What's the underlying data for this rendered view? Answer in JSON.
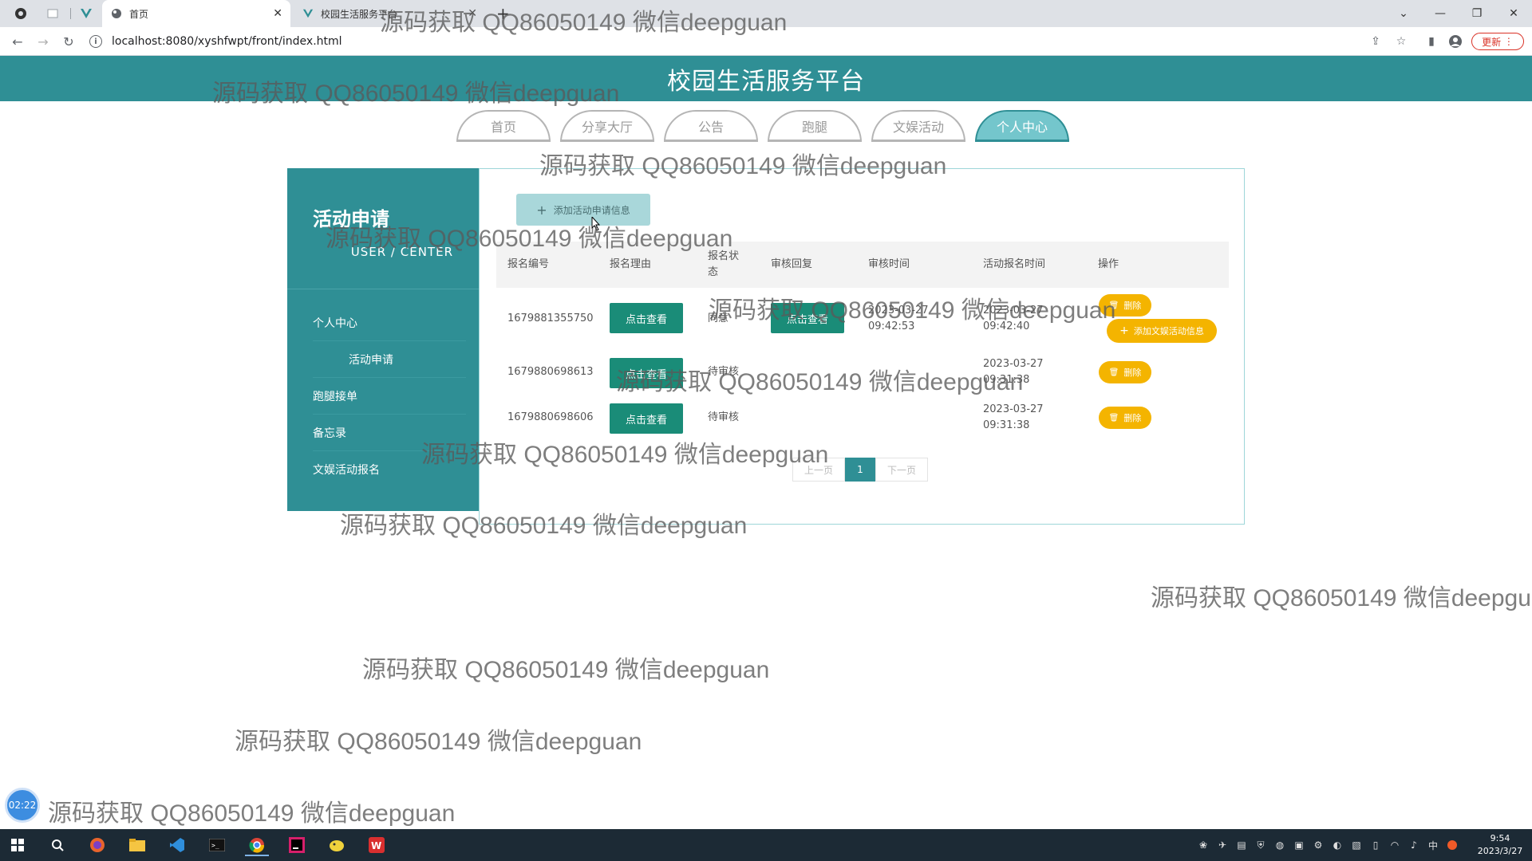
{
  "browser": {
    "tabs": [
      {
        "title": "首页"
      },
      {
        "title": "校园生活服务平台"
      }
    ],
    "new_tab_symbol": "+",
    "url": "localhost:8080/xyshfwpt/front/index.html",
    "update_label": "更新"
  },
  "site": {
    "title": "校园生活服务平台",
    "nav": [
      "首页",
      "分享大厅",
      "公告",
      "跑腿",
      "文娱活动",
      "个人中心"
    ],
    "active_nav": "个人中心"
  },
  "sidebar": {
    "title": "活动申请",
    "subtitle": "USER / CENTER",
    "items": [
      {
        "label": "个人中心"
      },
      {
        "label": "活动申请"
      },
      {
        "label": "跑腿接单"
      },
      {
        "label": "备忘录"
      },
      {
        "label": "文娱活动报名"
      }
    ]
  },
  "main": {
    "add_button": "添加活动申请信息",
    "columns": [
      "报名编号",
      "报名理由",
      "报名状态",
      "审核回复",
      "审核时间",
      "活动报名时间",
      "操作"
    ],
    "rows": [
      {
        "id": "1679881355750",
        "reason_btn": "点击查看",
        "status": "同意",
        "reply_btn": "点击查看",
        "audit_date": "2023-03-27",
        "audit_time": "09:42:53",
        "signup_date": "2023-03-27",
        "signup_time": "09:42:40",
        "delete": "删除",
        "extra_action": "添加文娱活动信息"
      },
      {
        "id": "1679880698613",
        "reason_btn": "点击查看",
        "status": "待审核",
        "signup_date": "2023-03-27",
        "signup_time": "09:31:38",
        "delete": "删除"
      },
      {
        "id": "1679880698606",
        "reason_btn": "点击查看",
        "status": "待审核",
        "signup_date": "2023-03-27",
        "signup_time": "09:31:38",
        "delete": "删除"
      }
    ],
    "pager": {
      "prev": "上一页",
      "current": "1",
      "next": "下一页"
    }
  },
  "watermark_text": "源码获取 QQ86050149 微信deepguan",
  "timer": "02:22",
  "clock": {
    "time": "9:54",
    "date": "2023/3/27"
  },
  "tray": {
    "ime": "中"
  },
  "colors": {
    "primary": "#2f8f95",
    "view_button": "#1a8c78",
    "delete_button": "#f4b400",
    "nav_active": "#74c6cc"
  }
}
